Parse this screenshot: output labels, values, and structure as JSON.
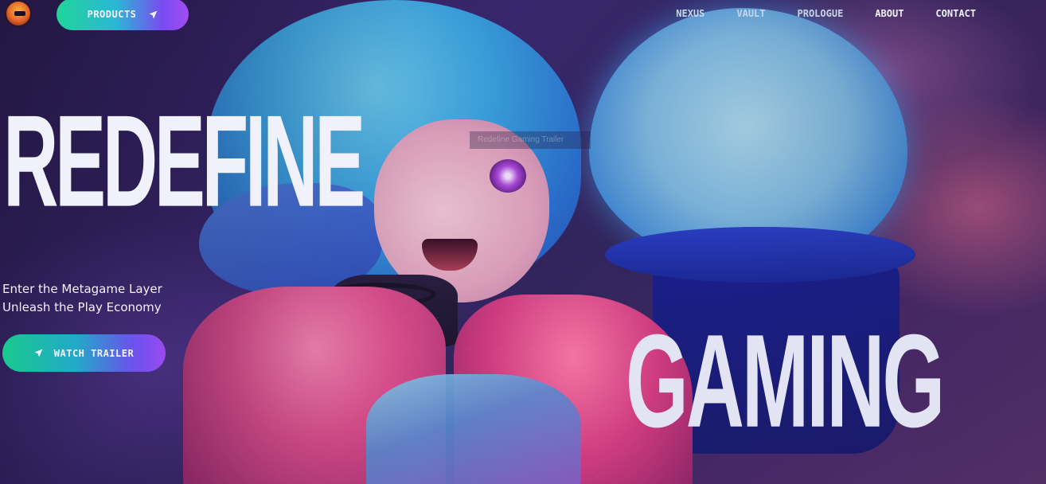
{
  "navbar": {
    "logo_alt": "gamer-mascot-logo",
    "products_label": "PRODUCTS",
    "links": [
      {
        "label": "NEXUS"
      },
      {
        "label": "VAULT"
      },
      {
        "label": "PROLOGUE"
      },
      {
        "label": "ABOUT"
      },
      {
        "label": "CONTACT"
      }
    ]
  },
  "hero": {
    "title_first": "REDEFINE",
    "title_second": "GAMING",
    "tagline_line1": "Enter the Metagame Layer",
    "tagline_line2": "Unleash the Play Economy",
    "cta_label": "WATCH TRAILER",
    "faded_overlay_text": "Redefine Gaming Trailer"
  },
  "colors": {
    "button_gradient_start": "#1fd59a",
    "button_gradient_mid": "#2bb7d6",
    "button_gradient_end": "#a14cf2",
    "headline_text": "#f0f1fb",
    "nav_text": "#eef2fb"
  },
  "icons": {
    "products_icon": "paper-plane-icon",
    "trailer_icon": "paper-plane-icon"
  }
}
